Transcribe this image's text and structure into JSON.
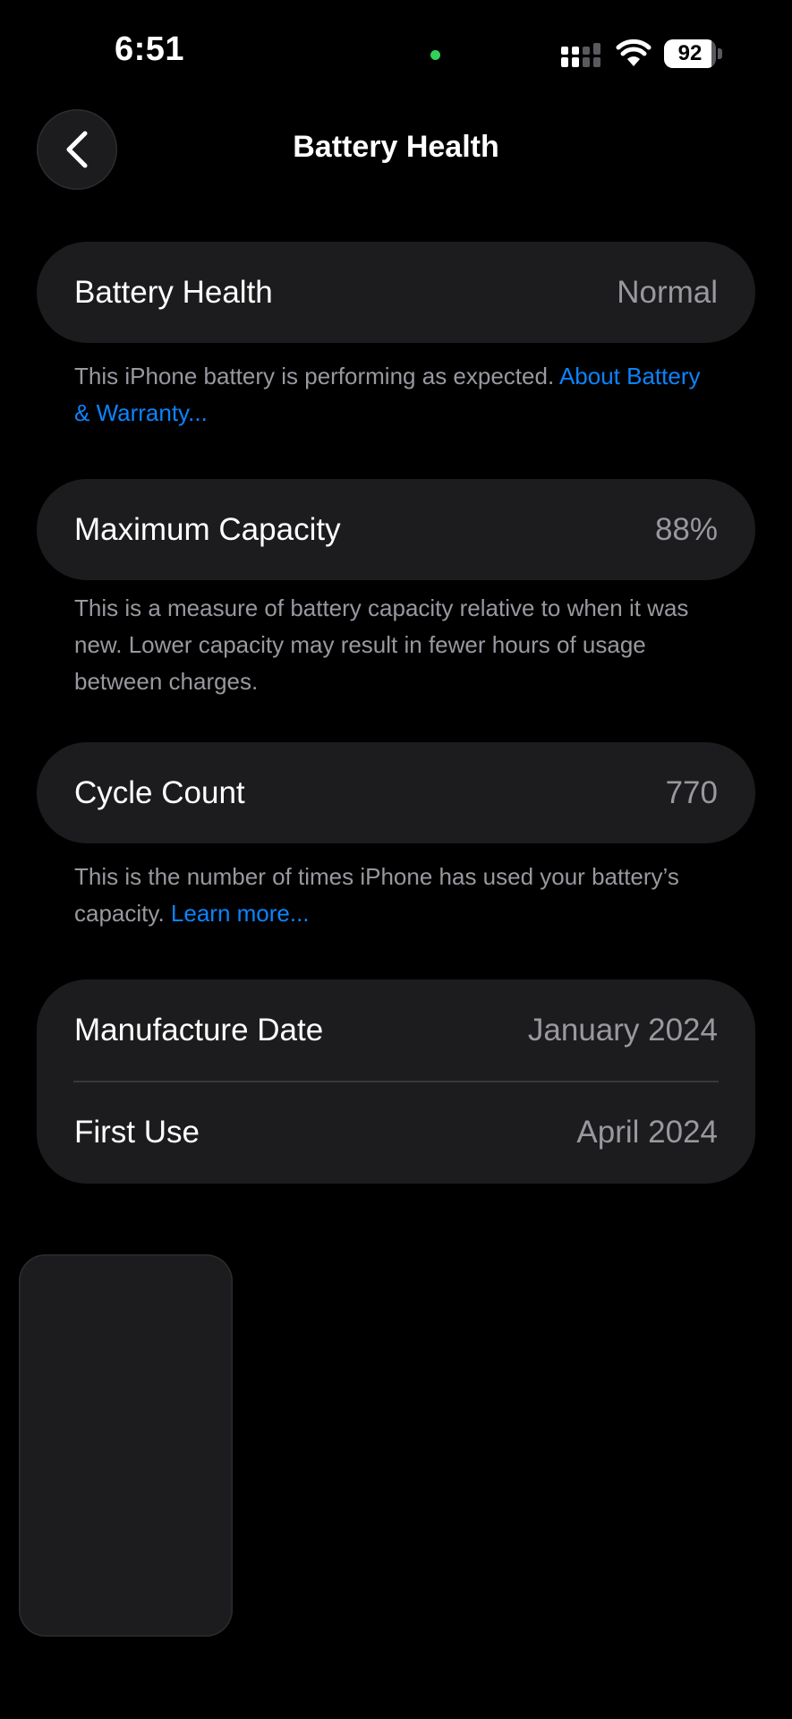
{
  "status_bar": {
    "time": "6:51",
    "battery_level": "92",
    "battery_fraction": 0.92,
    "privacy_indicator_color": "#30d158",
    "icons": [
      "signal-icon",
      "wifi-icon",
      "battery-icon"
    ]
  },
  "nav": {
    "title": "Battery Health",
    "back_icon": "chevron-left-icon"
  },
  "sections": {
    "health": {
      "label": "Battery Health",
      "value": "Normal",
      "footnote_text": "This iPhone battery is performing as expected. ",
      "footnote_link": "About Battery & Warranty..."
    },
    "capacity": {
      "label": "Maximum Capacity",
      "value": "88%",
      "footnote_text": "This is a measure of battery capacity relative to when it was new. Lower capacity may result in fewer hours of usage between charges."
    },
    "cycles": {
      "label": "Cycle Count",
      "value": "770",
      "footnote_text": "This is the number of times iPhone has used your battery’s capacity. ",
      "footnote_link": "Learn more..."
    },
    "dates": {
      "manufacture_label": "Manufacture Date",
      "manufacture_value": "January 2024",
      "first_use_label": "First Use",
      "first_use_value": "April 2024"
    }
  },
  "colors": {
    "background": "#000000",
    "card": "#1c1c1e",
    "secondary_text": "#98989f",
    "link": "#0a84ff"
  }
}
